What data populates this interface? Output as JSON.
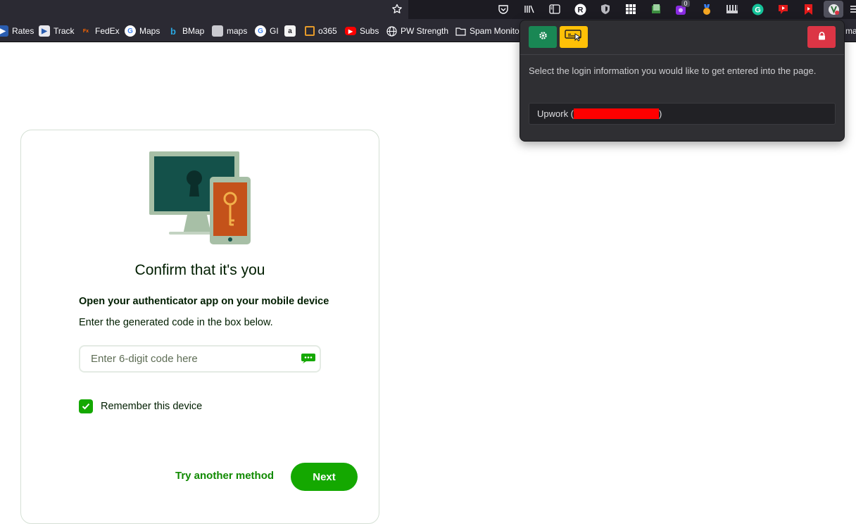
{
  "toolbar": {
    "extension_badge": "0"
  },
  "bookmarks": [
    {
      "label": "Rates"
    },
    {
      "label": "Track"
    },
    {
      "label": "FedEx"
    },
    {
      "label": "Maps"
    },
    {
      "label": "BMap"
    },
    {
      "label": "maps"
    },
    {
      "label": "GI"
    },
    {
      "label": ""
    },
    {
      "label": "o365"
    },
    {
      "label": "Subs"
    },
    {
      "label": "PW Strength"
    },
    {
      "label": "Spam Monito"
    },
    {
      "label": "ma"
    }
  ],
  "card": {
    "title": "Confirm that it's you",
    "instruction_strong": "Open your authenticator app on your mobile device",
    "instruction": "Enter the generated code in the box below.",
    "code_placeholder": "Enter 6-digit code here",
    "code_value": "",
    "remember_label": "Remember this device",
    "remember_checked": true,
    "try_another_label": "Try another method",
    "next_label": "Next"
  },
  "popup": {
    "description": "Select the login information you would like to get entered into the page.",
    "login_item_prefix": "Upwork (",
    "login_item_suffix": ")"
  },
  "colors": {
    "brand_green": "#14a800",
    "link_green": "#108a00",
    "popup_settings": "#198754",
    "popup_fill": "#ffc107",
    "popup_lock": "#dc3545",
    "redaction": "#ff0000"
  }
}
